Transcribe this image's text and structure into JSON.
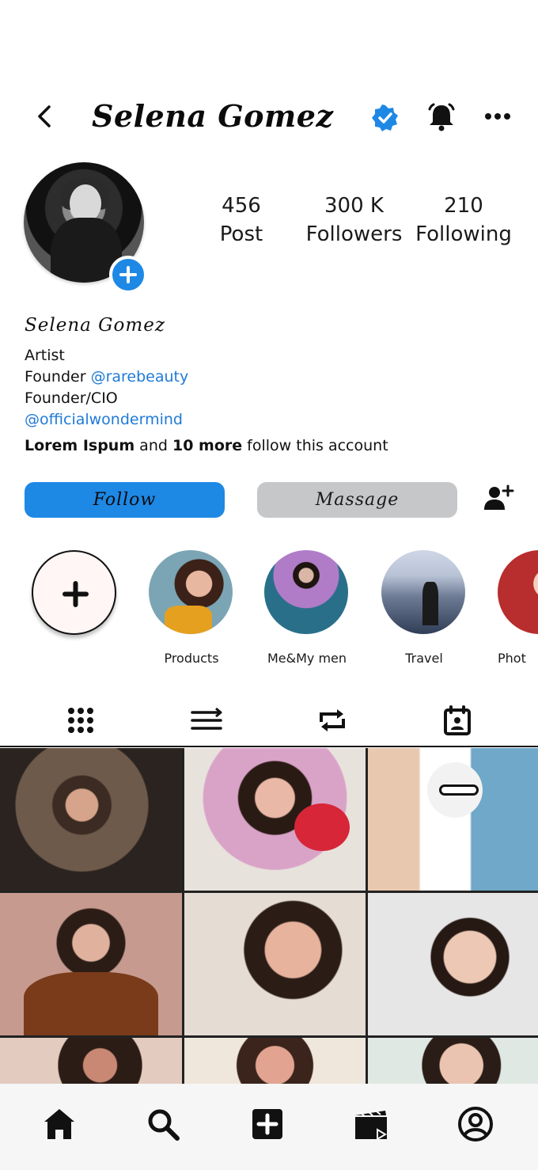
{
  "header": {
    "title": "Selena Gomez",
    "back_icon": "chevron-left-icon",
    "verified_icon": "verified-badge-icon",
    "bell_icon": "bell-icon",
    "more_icon": "more-horizontal-icon"
  },
  "profile": {
    "avatar_icon": "profile-avatar",
    "add_story_icon": "plus-circle-icon",
    "stats": [
      {
        "value": "456",
        "label": "Post"
      },
      {
        "value": "300 K",
        "label": "Followers"
      },
      {
        "value": "210",
        "label": "Following"
      }
    ],
    "bio": {
      "name": "Selena Gomez",
      "line1": "Artist",
      "line2_prefix": "Founder ",
      "line2_link": "@rarebeauty",
      "line3": "Founder/CIO",
      "line4_link": "@officialwondermind",
      "followed_by_1": "Lorem Ispum",
      "followed_by_and": " and ",
      "followed_by_more": "10 more",
      "followed_by_suffix": " follow this account"
    }
  },
  "actions": {
    "follow_label": "Follow",
    "message_label": "Massage",
    "add_person_icon": "add-person-icon"
  },
  "highlights": {
    "new_icon": "plus-icon",
    "items": [
      {
        "label": "Products"
      },
      {
        "label": "Me&My men"
      },
      {
        "label": "Travel"
      },
      {
        "label": "Phot"
      }
    ]
  },
  "tabs": [
    "grid-icon",
    "list-icon",
    "repost-icon",
    "calendar-icon"
  ],
  "bottom_nav": [
    "home-icon",
    "search-icon",
    "add-post-icon",
    "reels-icon",
    "profile-icon"
  ],
  "colors": {
    "accent": "#1e88e5",
    "link": "#1f7ad6",
    "message_button": "#c6c7c9"
  }
}
